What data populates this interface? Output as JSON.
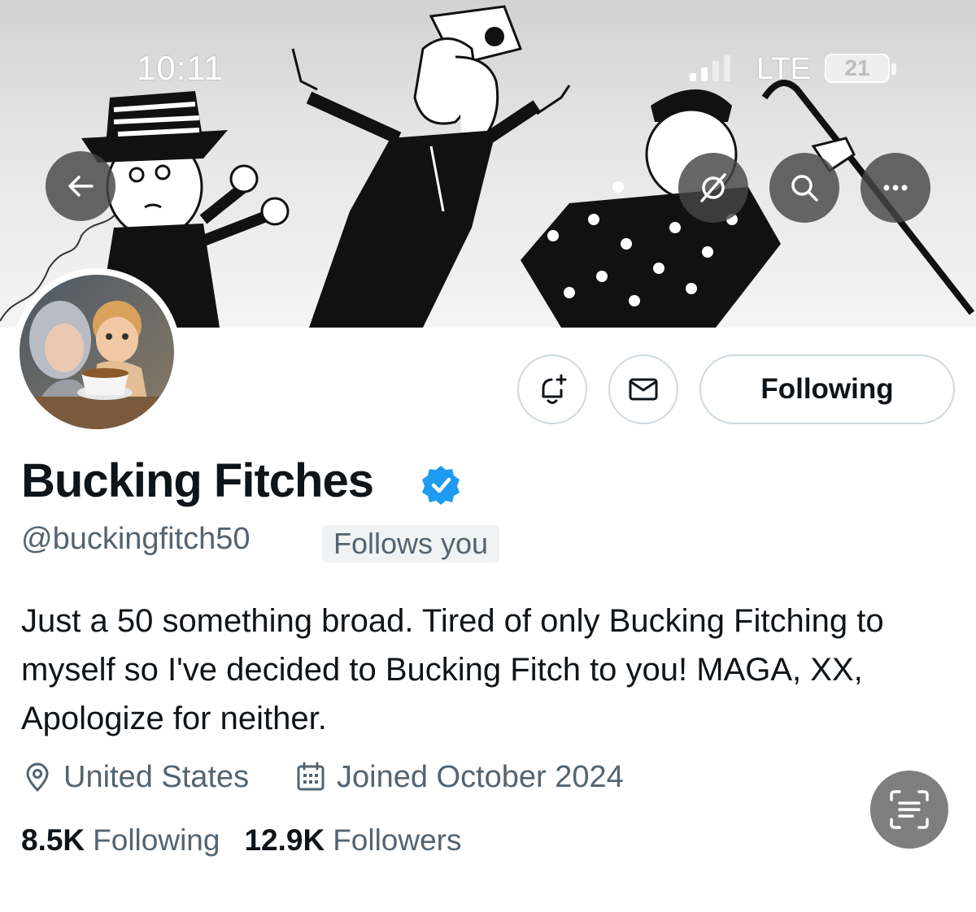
{
  "status_bar": {
    "time": "10:11",
    "network": "LTE",
    "battery": "21"
  },
  "banner": {
    "description_icons": [
      "cartoon-lady-hat-icon",
      "cartoon-dancer-icon",
      "cartoon-old-lady-cane-icon"
    ]
  },
  "nav": {
    "back_icon": "arrow-left-icon",
    "grok_icon": "grok-icon",
    "search_icon": "search-icon",
    "more_icon": "more-icon"
  },
  "actions": {
    "notify_icon": "bell-plus-icon",
    "message_icon": "envelope-icon",
    "follow_label": "Following"
  },
  "profile": {
    "display_name": "Bucking Fitches",
    "handle": "@buckingfitch50",
    "follows_you": "Follows you",
    "bio": "Just a 50 something broad. Tired of only Bucking Fitching to myself so I've decided to Bucking Fitch to you! MAGA, XX, Apologize for neither.",
    "location": "United States",
    "joined": "Joined October 2024",
    "following_count": "8.5K",
    "following_label": "Following",
    "followers_count": "12.9K",
    "followers_label": "Followers"
  },
  "colors": {
    "verified": "#1d9bf0",
    "text": "#0f1419",
    "secondary": "#536471",
    "border": "#cfd9de"
  }
}
